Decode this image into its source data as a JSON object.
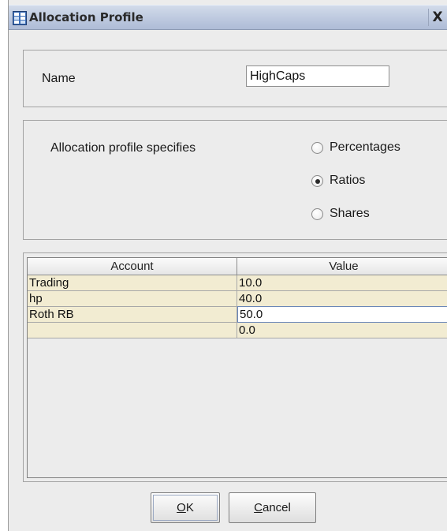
{
  "window": {
    "title": "Allocation Profile",
    "close_glyph": "X",
    "icon": "table-app-icon"
  },
  "name_section": {
    "label": "Name",
    "value": "HighCaps"
  },
  "profile_section": {
    "label": "Allocation profile specifies",
    "options": [
      {
        "label": "Percentages",
        "selected": false
      },
      {
        "label": "Ratios",
        "selected": true
      },
      {
        "label": "Shares",
        "selected": false
      }
    ]
  },
  "table": {
    "headers": {
      "account": "Account",
      "value": "Value"
    },
    "rows": [
      {
        "account": "Trading",
        "value": "10.0"
      },
      {
        "account": "hp",
        "value": "40.0"
      },
      {
        "account": "Roth RB",
        "value": "50.0"
      },
      {
        "account": "",
        "value": "0.0"
      }
    ],
    "row_color": "#f2ecd2"
  },
  "buttons": {
    "ok": {
      "mnemonic": "O",
      "rest": "K"
    },
    "cancel": {
      "mnemonic": "C",
      "rest": "ancel"
    }
  }
}
